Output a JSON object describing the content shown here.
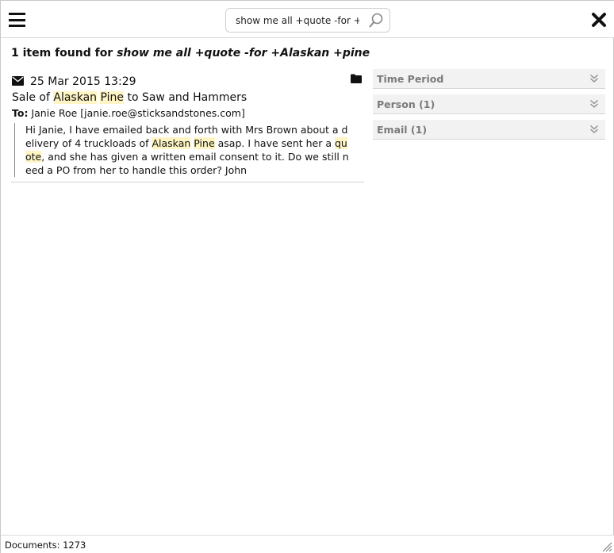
{
  "search": {
    "value": "show me all +quote -for +A",
    "placeholder": ""
  },
  "results": {
    "count_text": "1 item found for",
    "query": "show me all +quote -for +Alaskan +pine"
  },
  "item": {
    "date": "25 Mar 2015 13:29",
    "subject": {
      "pre": "Sale of ",
      "hl1": "Alaskan",
      "sp": " ",
      "hl2": "Pine",
      "post": " to Saw and Hammers"
    },
    "to_label": "To:",
    "to_value": "Janie Roe [janie.roe@sticksandstones.com]",
    "snippet": {
      "p1": "Hi Janie, I have emailed back and forth with Mrs Brown about a delivery of 4 truckloads of ",
      "hl1": "Alaskan",
      "sp": " ",
      "hl2": "Pine",
      "p2": " asap. I have sent her a ",
      "hl3": "quote",
      "p3": ", and she has given a written email consent to it. Do we still need a PO from her to handle this order? John"
    }
  },
  "filters": [
    {
      "label": "Time Period"
    },
    {
      "label": "Person (1)"
    },
    {
      "label": "Email (1)"
    }
  ],
  "status": {
    "documents": "Documents: 1273"
  },
  "icons": {
    "menu": "hamburger-menu-icon",
    "search": "magnifier-icon",
    "close": "close-x-icon",
    "envelope": "envelope-icon",
    "folder": "folder-icon",
    "chevron": "double-chevron-down-icon",
    "resize": "resize-grip-icon"
  },
  "colors": {
    "highlight": "#fff5c4",
    "filter_bg": "#f2f2f2",
    "filter_text": "#7a7a7a"
  }
}
